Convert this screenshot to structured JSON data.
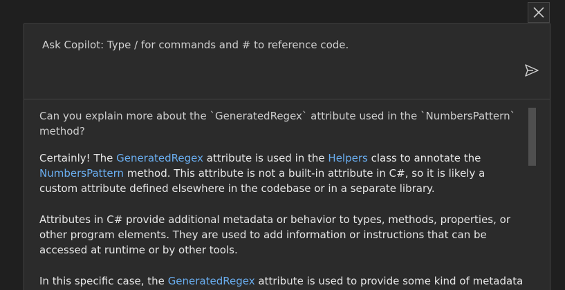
{
  "close_icon": "close-icon",
  "input": {
    "placeholder": "Ask Copilot: Type / for commands and # to reference code.",
    "send_icon": "send-icon"
  },
  "chat": {
    "question": "Can you explain more about the `GeneratedRegex` attribute used in the `NumbersPattern` method?",
    "answer_p1": {
      "t1": "Certainly! The ",
      "link1": "GeneratedRegex",
      "t2": " attribute is used in the ",
      "link2": "Helpers",
      "t3": " class to annotate the ",
      "link3": "NumbersPattern",
      "t4": " method. This attribute is not a built-in attribute in C#, so it is likely a custom attribute defined elsewhere in the codebase or in a separate library."
    },
    "answer_p2": "Attributes in C# provide additional metadata or behavior to types, methods, properties, or other program elements. They are used to add information or instructions that can be accessed at runtime or by other tools.",
    "answer_p3": {
      "t1": "In this specific case, the ",
      "link1": "GeneratedRegex",
      "t2": " attribute is used to provide some kind of metadata"
    }
  },
  "colors": {
    "background": "#1f1f1f",
    "panel": "#2b2b2b",
    "border": "#454545",
    "link": "#6aaef0",
    "text": "#cccccc"
  }
}
